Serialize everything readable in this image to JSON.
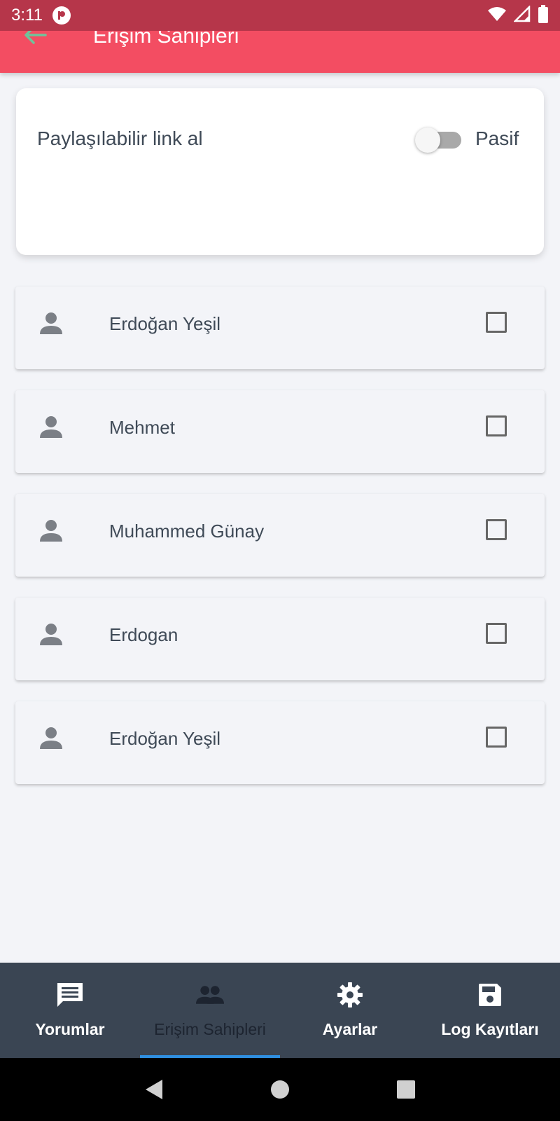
{
  "status_bar": {
    "time": "3:11",
    "icons": [
      "app-notification-icon",
      "wifi-icon",
      "cell-signal-icon",
      "battery-icon"
    ]
  },
  "app_bar": {
    "title": "Erişim Sahipleri",
    "back_icon": "arrow-left-icon",
    "background": "#f34d62",
    "status_background": "#b6364a"
  },
  "share_link": {
    "label": "Paylaşılabilir link al",
    "toggle_on": false,
    "state_label": "Pasif"
  },
  "users": [
    {
      "name": "Erdoğan Yeşil",
      "checked": false,
      "icon": "person-icon"
    },
    {
      "name": "Mehmet",
      "checked": false,
      "icon": "person-icon"
    },
    {
      "name": "Muhammed Günay",
      "checked": false,
      "icon": "person-icon"
    },
    {
      "name": "Erdogan",
      "checked": false,
      "icon": "person-icon"
    },
    {
      "name": "Erdoğan Yeşil",
      "checked": false,
      "icon": "person-icon"
    }
  ],
  "bottom_nav": {
    "items": [
      {
        "label": "Yorumlar",
        "icon": "comment-icon",
        "active": false
      },
      {
        "label": "Erişim Sahipleri",
        "icon": "people-icon",
        "active": true
      },
      {
        "label": "Ayarlar",
        "icon": "gear-icon",
        "active": false
      },
      {
        "label": "Log Kayıtları",
        "icon": "save-icon",
        "active": false
      }
    ],
    "background": "#3a4553",
    "indicator_color": "#2f8fe0"
  },
  "system_nav": {
    "icons": [
      "back-triangle-icon",
      "home-circle-icon",
      "recents-square-icon"
    ]
  }
}
